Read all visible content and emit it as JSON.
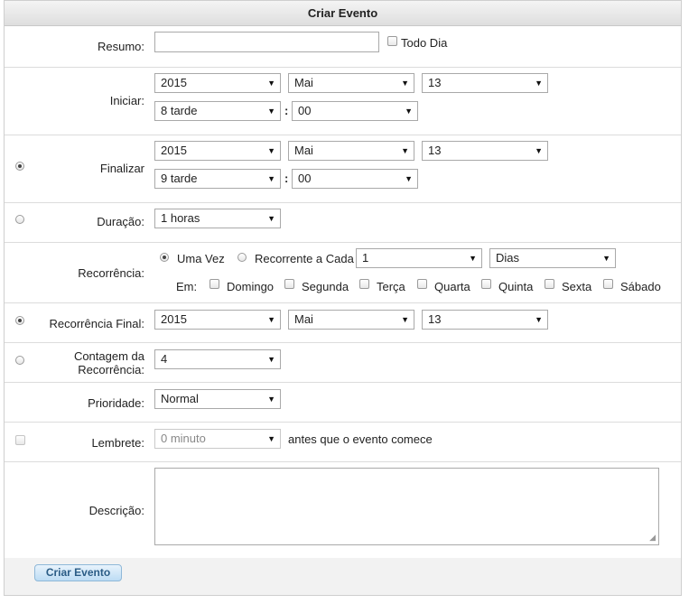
{
  "header": {
    "title": "Criar Evento"
  },
  "resumo": {
    "label": "Resumo:",
    "value": "",
    "all_day_label": "Todo Dia"
  },
  "iniciar": {
    "label": "Iniciar:",
    "year": "2015",
    "month": "Mai",
    "day": "13",
    "hour": "8 tarde",
    "minute": "00"
  },
  "finalizar": {
    "label": "Finalizar",
    "year": "2015",
    "month": "Mai",
    "day": "13",
    "hour": "9 tarde",
    "minute": "00"
  },
  "duracao": {
    "label": "Duração:",
    "value": "1 horas"
  },
  "recorrencia": {
    "label": "Recorrência:",
    "once_label": "Uma Vez",
    "every_label": "Recorrente a Cada",
    "every_value": "1",
    "unit_value": "Dias",
    "on_label": "Em:",
    "days": [
      "Domingo",
      "Segunda",
      "Terça",
      "Quarta",
      "Quinta",
      "Sexta",
      "Sábado"
    ]
  },
  "recorrencia_final": {
    "label": "Recorrência Final:",
    "year": "2015",
    "month": "Mai",
    "day": "13"
  },
  "contagem": {
    "label_line1": "Contagem da",
    "label_line2": "Recorrência:",
    "value": "4"
  },
  "prioridade": {
    "label": "Prioridade:",
    "value": "Normal"
  },
  "lembrete": {
    "label": "Lembrete:",
    "value": "0 minuto",
    "suffix": "antes que o evento comece"
  },
  "descricao": {
    "label": "Descrição:",
    "value": ""
  },
  "submit": {
    "label": "Criar Evento"
  },
  "time_separator": ":",
  "arrow": "▼"
}
